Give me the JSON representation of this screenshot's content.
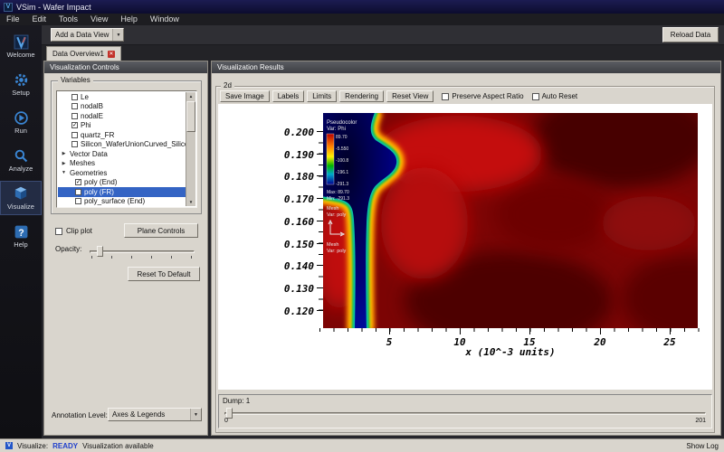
{
  "icons": {
    "close": "✕",
    "dropdown": "▼",
    "collapsed": "▶",
    "expanded": "▼",
    "check": "✓",
    "scroll_up": "▲",
    "scroll_down": "▼",
    "logo_letter": "V"
  },
  "titlebar": {
    "title": "VSim - Wafer Impact"
  },
  "menubar": {
    "items": [
      "File",
      "Edit",
      "Tools",
      "View",
      "Help",
      "Window"
    ]
  },
  "toolbar": {
    "add_data_view": "Add a Data View",
    "reload_data": "Reload Data"
  },
  "sidebar": {
    "items": [
      "Welcome",
      "Setup",
      "Run",
      "Analyze",
      "Visualize",
      "Help"
    ],
    "active": "Visualize"
  },
  "tabs": {
    "active": "Data Overview1"
  },
  "controls": {
    "header": "Visualization Controls",
    "variables_title": "Variables",
    "tree": [
      "Le",
      "nodalB",
      "nodalE",
      "Phi",
      "quartz_FR",
      "Silicon_WaferUnionCurved_Silico...",
      "Vector Data",
      "Meshes",
      "Geometries",
      "poly (End)",
      "poly (FR)",
      "poly_surface (End)"
    ],
    "clip_plot": "Clip plot",
    "plane_controls": "Plane Controls",
    "opacity": "Opacity:",
    "reset_to_default": "Reset To Default",
    "annotation_level": "Annotation Level:",
    "annotation_value": "Axes & Legends"
  },
  "results": {
    "header": "Visualization Results",
    "view_mode": "2d",
    "buttons": [
      "Save Image",
      "Labels",
      "Limits",
      "Rendering",
      "Reset View"
    ],
    "preserve_aspect": "Preserve Aspect Ratio",
    "auto_reset": "Auto Reset",
    "dump_label": "Dump: 1",
    "dump_min": "0",
    "dump_max": "201"
  },
  "plot": {
    "legend": {
      "title": "Pseudocolor",
      "var": "Var: Phi",
      "ticks": [
        "89.70",
        "-5.550",
        "-100.8",
        "-196.1",
        "-291.3"
      ],
      "max": "Max: 89.70",
      "min": "Min: -291.3",
      "mesh1_title": "Mesh",
      "mesh1_var": "Var: poly",
      "mesh2_title": "Mesh",
      "mesh2_var": "Var: poly"
    },
    "y_ticks": [
      "0.200",
      "0.190",
      "0.180",
      "0.170",
      "0.160",
      "0.150",
      "0.140",
      "0.130",
      "0.120"
    ],
    "x_ticks": [
      "5",
      "10",
      "15",
      "20",
      "25"
    ],
    "x_label": "x (10^-3 units)"
  },
  "statusbar": {
    "prefix": "Visualize:",
    "status": "READY",
    "message": "Visualization available",
    "show_log": "Show Log"
  }
}
